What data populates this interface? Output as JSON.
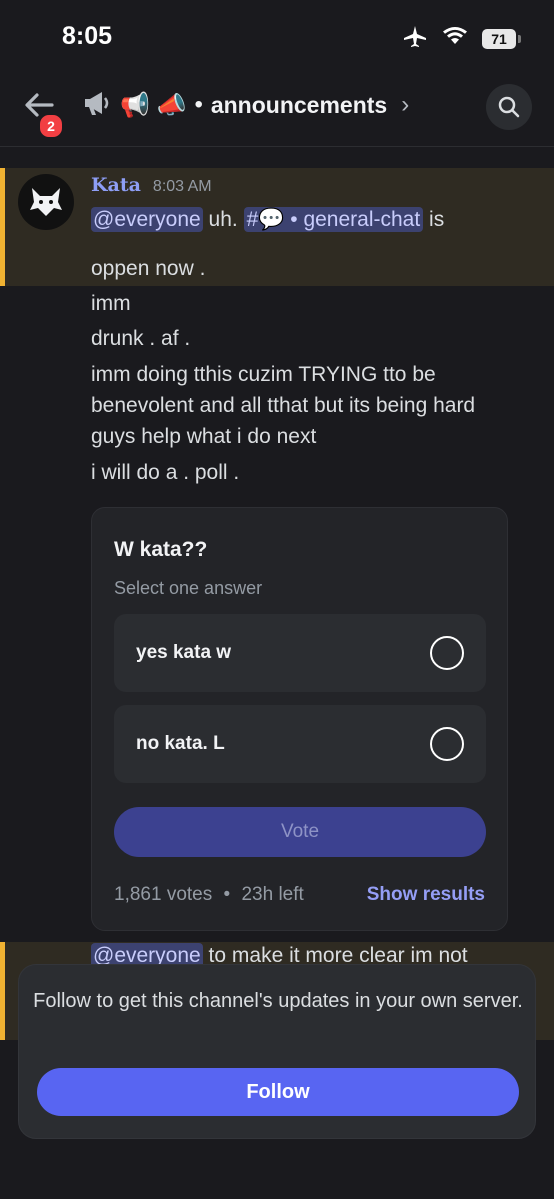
{
  "status": {
    "time": "8:05",
    "battery": "71"
  },
  "header": {
    "badge_count": "2",
    "channel_emojis": "📢 📣",
    "separator": "•",
    "channel_name": "announcements",
    "chevron": "›"
  },
  "message": {
    "author": "Kata",
    "timestamp": "8:03 AM",
    "line1": {
      "mention": "@everyone",
      "text_a": " uh. ",
      "channel_mention": "#💬 • general-chat",
      "text_b": " is"
    },
    "lines": [
      "oppen now .",
      "imm",
      "drunk . af .",
      "imm doing tthis cuzim TRYING tto be",
      "benevolent and all tthat but its being hard",
      "guys help what i do next",
      "i will do a . poll ."
    ]
  },
  "poll": {
    "question": "W kata??",
    "hint": "Select one answer",
    "options": [
      {
        "label": "yes kata w"
      },
      {
        "label": "no kata. L"
      }
    ],
    "vote_label": "Vote",
    "votes": "1,861 votes",
    "time_left": "23h left",
    "footer_sep": "•",
    "show_results": "Show results"
  },
  "next_message": {
    "mention": "@everyone",
    "text": " to make it more clear im not"
  },
  "follow": {
    "text": "Follow to get this channel's updates in your own server.",
    "button": "Follow"
  },
  "colors": {
    "accent": "#5865f2",
    "highlight_bar": "#f0b232",
    "mention_bg": "#3c4270"
  }
}
